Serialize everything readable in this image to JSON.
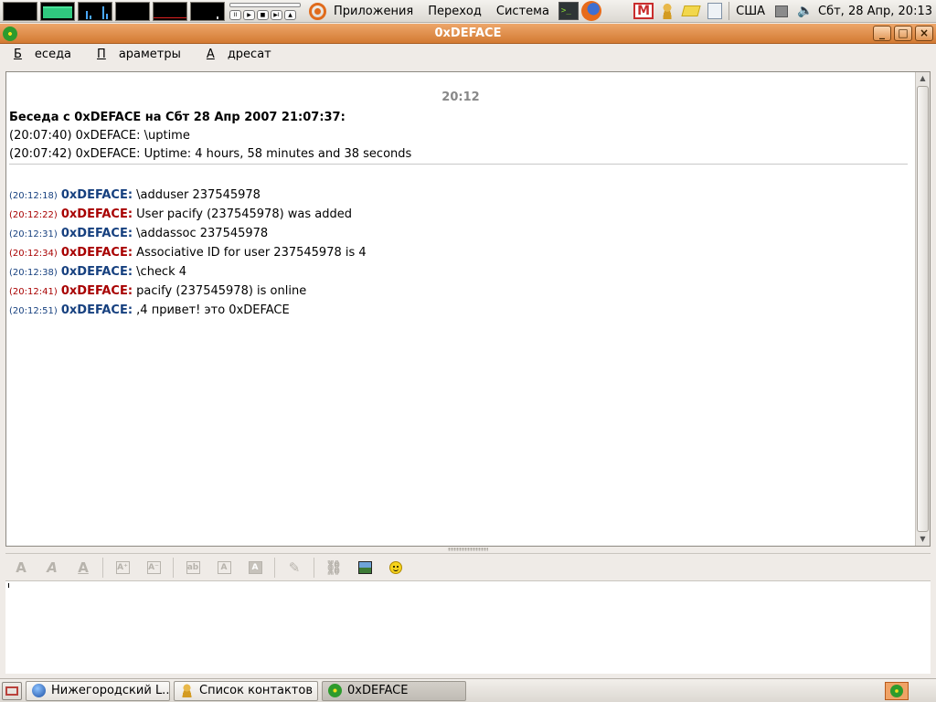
{
  "top_panel": {
    "menus": [
      "Приложения",
      "Переход",
      "Система"
    ],
    "keyboard_layout": "США",
    "clock": "Сбт, 28 Апр, 20:13"
  },
  "window": {
    "title": "0xDEFACE",
    "buttons": {
      "minimize": "_",
      "maximize": "□",
      "close": "×"
    }
  },
  "menubar": {
    "items": [
      {
        "first": "Б",
        "rest": "еседа"
      },
      {
        "first": "П",
        "rest": "араметры"
      },
      {
        "first": "А",
        "rest": "дресат"
      }
    ]
  },
  "history": {
    "time_marker": "20:12",
    "old_header": "Беседа с 0xDEFACE на Сбт 28 Апр 2007 21:07:37:",
    "old_lines": [
      "(20:07:40) 0xDEFACE: \\uptime",
      "(20:07:42) 0xDEFACE: Uptime: 4 hours, 58 minutes and 38 seconds"
    ],
    "messages": [
      {
        "ts": "(20:12:18)",
        "nick": "0xDEFACE:",
        "text": "\\adduser 237545978",
        "dir": "me"
      },
      {
        "ts": "(20:12:22)",
        "nick": "0xDEFACE:",
        "text": "User pacify (237545978) was added",
        "dir": "them"
      },
      {
        "ts": "(20:12:31)",
        "nick": "0xDEFACE:",
        "text": "\\addassoc 237545978",
        "dir": "me"
      },
      {
        "ts": "(20:12:34)",
        "nick": "0xDEFACE:",
        "text": "Associative ID for user 237545978 is 4",
        "dir": "them"
      },
      {
        "ts": "(20:12:38)",
        "nick": "0xDEFACE:",
        "text": "\\check 4",
        "dir": "me"
      },
      {
        "ts": "(20:12:41)",
        "nick": "0xDEFACE:",
        "text": "pacify (237545978) is online",
        "dir": "them"
      },
      {
        "ts": "(20:12:51)",
        "nick": "0xDEFACE:",
        "text": ",4 привет! это 0xDEFACE",
        "dir": "me"
      }
    ]
  },
  "colors": {
    "outgoing": "#16407f",
    "incoming": "#a80000",
    "title_bar": "#e08f4b"
  },
  "taskbar": {
    "tasks": [
      "Нижегородский L...",
      "Список контактов",
      "0xDEFACE"
    ]
  }
}
